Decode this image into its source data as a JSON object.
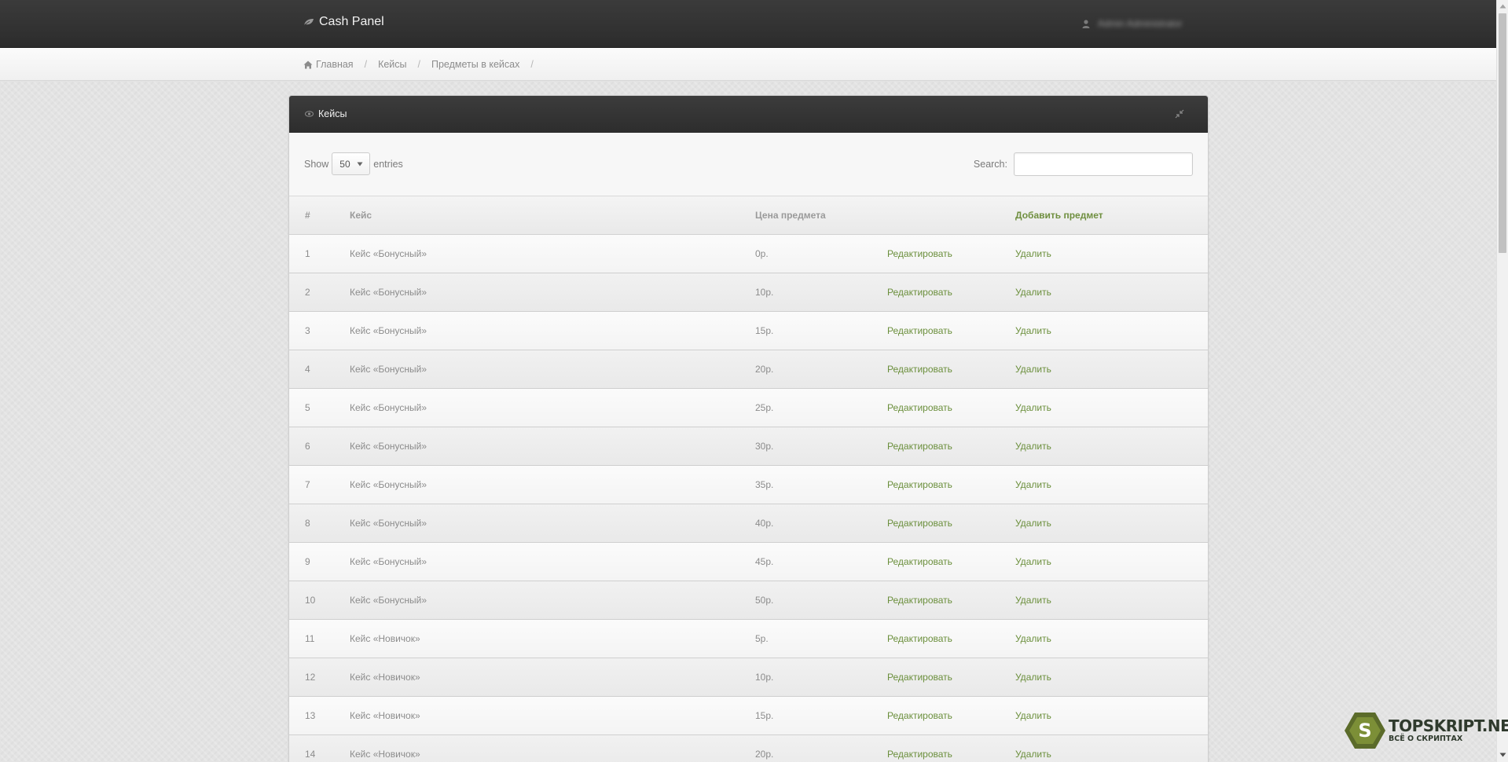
{
  "header": {
    "brand": "Cash Panel",
    "user_name": "Admin Administrator"
  },
  "breadcrumbs": {
    "items": [
      "Главная",
      "Кейсы",
      "Предметы в кейсах"
    ],
    "separator": "/"
  },
  "panel": {
    "title": "Кейсы"
  },
  "controls": {
    "show_label": "Show",
    "entries_value": "50",
    "entries_label": "entries",
    "search_label": "Search:",
    "search_value": ""
  },
  "table": {
    "headers": [
      "#",
      "Кейс",
      "Цена предмета",
      "",
      "Добавить предмет"
    ],
    "edit_label": "Редактировать",
    "delete_label": "Удалить",
    "rows": [
      {
        "id": "1",
        "case": "Кейс «Бонусный»",
        "price": "0р."
      },
      {
        "id": "2",
        "case": "Кейс «Бонусный»",
        "price": "10р."
      },
      {
        "id": "3",
        "case": "Кейс «Бонусный»",
        "price": "15р."
      },
      {
        "id": "4",
        "case": "Кейс «Бонусный»",
        "price": "20р."
      },
      {
        "id": "5",
        "case": "Кейс «Бонусный»",
        "price": "25р."
      },
      {
        "id": "6",
        "case": "Кейс «Бонусный»",
        "price": "30р."
      },
      {
        "id": "7",
        "case": "Кейс «Бонусный»",
        "price": "35р."
      },
      {
        "id": "8",
        "case": "Кейс «Бонусный»",
        "price": "40р."
      },
      {
        "id": "9",
        "case": "Кейс «Бонусный»",
        "price": "45р."
      },
      {
        "id": "10",
        "case": "Кейс «Бонусный»",
        "price": "50р."
      },
      {
        "id": "11",
        "case": "Кейс «Новичок»",
        "price": "5р."
      },
      {
        "id": "12",
        "case": "Кейс «Новичок»",
        "price": "10р."
      },
      {
        "id": "13",
        "case": "Кейс «Новичок»",
        "price": "15р."
      },
      {
        "id": "14",
        "case": "Кейс «Новичок»",
        "price": "20р."
      }
    ]
  },
  "watermark": {
    "letter": "S",
    "title": "TOPSKRIPT.NET",
    "subtitle": "ВСЁ О СКРИПТАХ"
  },
  "icons": {
    "brand": "leaf-icon",
    "user": "user-icon",
    "home": "home-icon",
    "panel": "eye-icon",
    "collapse": "collapse-icon",
    "select": "caret-down-icon"
  },
  "colors": {
    "topbar": "#333333",
    "link_green": "#6b8f3c",
    "text_gray": "#8c8c8c",
    "background": "#e3e3e3"
  }
}
